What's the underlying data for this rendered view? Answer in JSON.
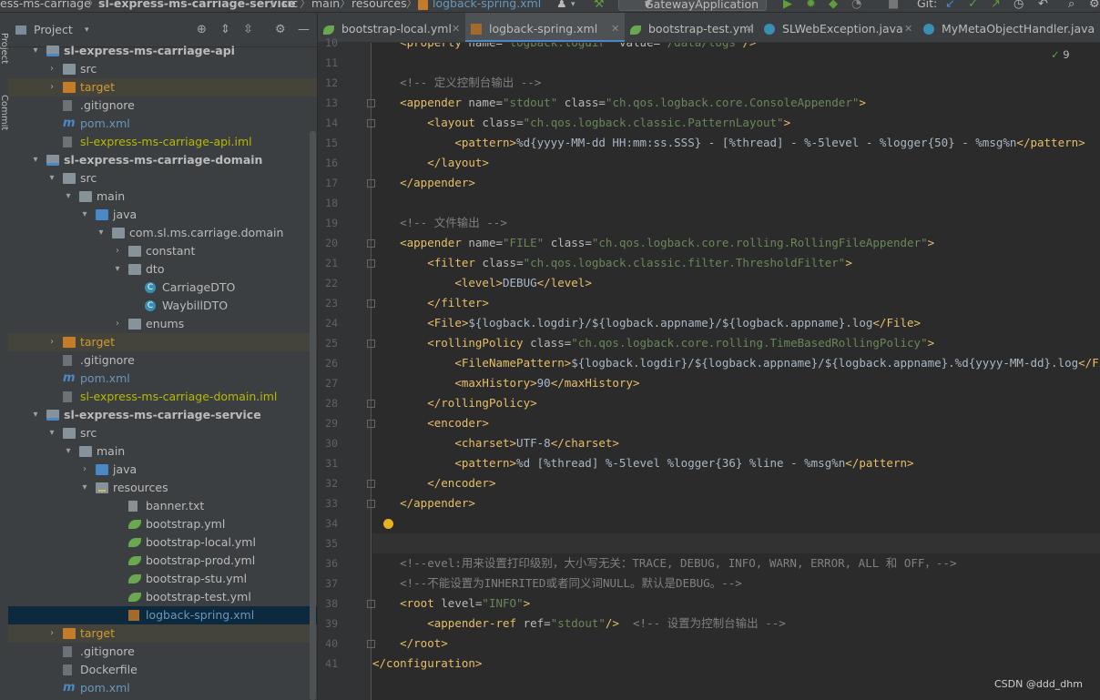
{
  "breadcrumb": {
    "items": [
      "ess-ms-carriage",
      "sl-express-ms-carriage-service",
      "src",
      "main",
      "resources",
      "logback-spring.xml"
    ],
    "separator": "〉",
    "run_config": "GatewayApplication",
    "git_label": "Git:"
  },
  "project_panel": {
    "title": "Project",
    "rows": [
      {
        "depth": 2,
        "arrow": "▾",
        "icon": "folder-mod",
        "label": "sl-express-ms-carriage-api",
        "cls": "c-mod",
        "row": ""
      },
      {
        "depth": 3,
        "arrow": "›",
        "icon": "folder-src",
        "label": "src",
        "cls": "c-norm",
        "row": ""
      },
      {
        "depth": 3,
        "arrow": "›",
        "icon": "folder-target",
        "label": "target",
        "cls": "c-target",
        "row": "excluded"
      },
      {
        "depth": 3,
        "arrow": "",
        "icon": "git",
        "label": ".gitignore",
        "cls": "c-norm",
        "row": ""
      },
      {
        "depth": 3,
        "arrow": "",
        "icon": "maven",
        "label": "pom.xml",
        "cls": "c-pom",
        "row": ""
      },
      {
        "depth": 3,
        "arrow": "",
        "icon": "iml",
        "label": "sl-express-ms-carriage-api.iml",
        "cls": "c-iml",
        "row": ""
      },
      {
        "depth": 2,
        "arrow": "▾",
        "icon": "folder-mod",
        "label": "sl-express-ms-carriage-domain",
        "cls": "c-mod",
        "row": ""
      },
      {
        "depth": 3,
        "arrow": "▾",
        "icon": "folder-src",
        "label": "src",
        "cls": "c-norm",
        "row": ""
      },
      {
        "depth": 4,
        "arrow": "▾",
        "icon": "folder",
        "label": "main",
        "cls": "c-norm",
        "row": ""
      },
      {
        "depth": 5,
        "arrow": "▾",
        "icon": "folder-java",
        "label": "java",
        "cls": "c-norm",
        "row": ""
      },
      {
        "depth": 6,
        "arrow": "▾",
        "icon": "pkg",
        "label": "com.sl.ms.carriage.domain",
        "cls": "c-norm",
        "row": ""
      },
      {
        "depth": 7,
        "arrow": "›",
        "icon": "pkg",
        "label": "constant",
        "cls": "c-norm",
        "row": ""
      },
      {
        "depth": 7,
        "arrow": "▾",
        "icon": "pkg",
        "label": "dto",
        "cls": "c-norm",
        "row": ""
      },
      {
        "depth": 8,
        "arrow": "",
        "icon": "cls",
        "label": "CarriageDTO",
        "cls": "c-norm",
        "row": ""
      },
      {
        "depth": 8,
        "arrow": "",
        "icon": "cls",
        "label": "WaybillDTO",
        "cls": "c-norm",
        "row": ""
      },
      {
        "depth": 7,
        "arrow": "›",
        "icon": "pkg",
        "label": "enums",
        "cls": "c-norm",
        "row": ""
      },
      {
        "depth": 3,
        "arrow": "›",
        "icon": "folder-target",
        "label": "target",
        "cls": "c-target",
        "row": "excluded"
      },
      {
        "depth": 3,
        "arrow": "",
        "icon": "git",
        "label": ".gitignore",
        "cls": "c-norm",
        "row": ""
      },
      {
        "depth": 3,
        "arrow": "",
        "icon": "maven",
        "label": "pom.xml",
        "cls": "c-pom",
        "row": ""
      },
      {
        "depth": 3,
        "arrow": "",
        "icon": "iml",
        "label": "sl-express-ms-carriage-domain.iml",
        "cls": "c-iml",
        "row": ""
      },
      {
        "depth": 2,
        "arrow": "▾",
        "icon": "folder-mod",
        "label": "sl-express-ms-carriage-service",
        "cls": "c-mod",
        "row": ""
      },
      {
        "depth": 3,
        "arrow": "▾",
        "icon": "folder-src",
        "label": "src",
        "cls": "c-norm",
        "row": ""
      },
      {
        "depth": 4,
        "arrow": "▾",
        "icon": "folder",
        "label": "main",
        "cls": "c-norm",
        "row": ""
      },
      {
        "depth": 5,
        "arrow": "›",
        "icon": "folder-java",
        "label": "java",
        "cls": "c-norm",
        "row": ""
      },
      {
        "depth": 5,
        "arrow": "▾",
        "icon": "folder-res",
        "label": "resources",
        "cls": "c-norm",
        "row": ""
      },
      {
        "depth": 7,
        "arrow": "",
        "icon": "txt",
        "label": "banner.txt",
        "cls": "c-norm",
        "row": ""
      },
      {
        "depth": 7,
        "arrow": "",
        "icon": "leaf",
        "label": "bootstrap.yml",
        "cls": "c-norm",
        "row": ""
      },
      {
        "depth": 7,
        "arrow": "",
        "icon": "leaf",
        "label": "bootstrap-local.yml",
        "cls": "c-norm",
        "row": ""
      },
      {
        "depth": 7,
        "arrow": "",
        "icon": "leaf",
        "label": "bootstrap-prod.yml",
        "cls": "c-norm",
        "row": ""
      },
      {
        "depth": 7,
        "arrow": "",
        "icon": "leaf",
        "label": "bootstrap-stu.yml",
        "cls": "c-norm",
        "row": ""
      },
      {
        "depth": 7,
        "arrow": "",
        "icon": "leaf",
        "label": "bootstrap-test.yml",
        "cls": "c-norm",
        "row": ""
      },
      {
        "depth": 7,
        "arrow": "",
        "icon": "xml",
        "label": "logback-spring.xml",
        "cls": "c-sel",
        "row": "selected"
      },
      {
        "depth": 3,
        "arrow": "›",
        "icon": "folder-target",
        "label": "target",
        "cls": "c-target",
        "row": "excluded"
      },
      {
        "depth": 3,
        "arrow": "",
        "icon": "git",
        "label": ".gitignore",
        "cls": "c-norm",
        "row": ""
      },
      {
        "depth": 3,
        "arrow": "",
        "icon": "docker",
        "label": "Dockerfile",
        "cls": "c-norm",
        "row": ""
      },
      {
        "depth": 3,
        "arrow": "",
        "icon": "maven",
        "label": "pom.xml",
        "cls": "c-pom",
        "row": ""
      }
    ]
  },
  "tabs": [
    {
      "label": "bootstrap-local.yml",
      "icon": "leaf",
      "active": false
    },
    {
      "label": "logback-spring.xml",
      "icon": "xml",
      "active": true
    },
    {
      "label": "bootstrap-test.yml",
      "icon": "leaf",
      "active": false
    },
    {
      "label": "SLWebException.java",
      "icon": "cls",
      "active": false
    },
    {
      "label": "MyMetaObjectHandler.java",
      "icon": "cls",
      "active": false
    }
  ],
  "editor": {
    "inspection_count": "9",
    "first_line": 10,
    "current_line": 35,
    "lines": [
      [
        [
          "    ",
          "txt"
        ],
        [
          "<property ",
          "tag"
        ],
        [
          "name=",
          "attr"
        ],
        [
          "\"logback.logdir\"",
          "val"
        ],
        [
          " value=",
          "attr"
        ],
        [
          "\"/data/logs\"",
          "val"
        ],
        [
          "/>",
          "tag"
        ]
      ],
      [],
      [
        [
          "    ",
          "txt"
        ],
        [
          "<!-- 定义控制台输出 -->",
          "cmt"
        ]
      ],
      [
        [
          "    ",
          "txt"
        ],
        [
          "<appender ",
          "tag"
        ],
        [
          "name=",
          "attr"
        ],
        [
          "\"stdout\"",
          "val"
        ],
        [
          " class=",
          "attr"
        ],
        [
          "\"ch.qos.logback.core.ConsoleAppender\"",
          "val"
        ],
        [
          ">",
          "tag"
        ]
      ],
      [
        [
          "        ",
          "txt"
        ],
        [
          "<layout ",
          "tag"
        ],
        [
          "class=",
          "attr"
        ],
        [
          "\"ch.qos.logback.classic.PatternLayout\"",
          "val"
        ],
        [
          ">",
          "tag"
        ]
      ],
      [
        [
          "            ",
          "txt"
        ],
        [
          "<pattern>",
          "tag"
        ],
        [
          "%d{yyyy-MM-dd HH:mm:ss.SSS} - [%thread] - %-5level - %logger{50} - %msg%n",
          "txt"
        ],
        [
          "</pattern>",
          "tag"
        ]
      ],
      [
        [
          "        ",
          "txt"
        ],
        [
          "</layout>",
          "tag"
        ]
      ],
      [
        [
          "    ",
          "txt"
        ],
        [
          "</appender>",
          "tag"
        ]
      ],
      [],
      [
        [
          "    ",
          "txt"
        ],
        [
          "<!-- 文件输出 -->",
          "cmt"
        ]
      ],
      [
        [
          "    ",
          "txt"
        ],
        [
          "<appender ",
          "tag"
        ],
        [
          "name=",
          "attr"
        ],
        [
          "\"FILE\"",
          "val"
        ],
        [
          " class=",
          "attr"
        ],
        [
          "\"ch.qos.logback.core.rolling.RollingFileAppender\"",
          "val"
        ],
        [
          ">",
          "tag"
        ]
      ],
      [
        [
          "        ",
          "txt"
        ],
        [
          "<filter ",
          "tag"
        ],
        [
          "class=",
          "attr"
        ],
        [
          "\"ch.qos.logback.classic.filter.ThresholdFilter\"",
          "val"
        ],
        [
          ">",
          "tag"
        ]
      ],
      [
        [
          "            ",
          "txt"
        ],
        [
          "<level>",
          "tag"
        ],
        [
          "DEBUG",
          "txt"
        ],
        [
          "</level>",
          "tag"
        ]
      ],
      [
        [
          "        ",
          "txt"
        ],
        [
          "</filter>",
          "tag"
        ]
      ],
      [
        [
          "        ",
          "txt"
        ],
        [
          "<File>",
          "tag"
        ],
        [
          "${logback.logdir}/${logback.appname}/${logback.appname}.log",
          "txt"
        ],
        [
          "</File>",
          "tag"
        ]
      ],
      [
        [
          "        ",
          "txt"
        ],
        [
          "<rollingPolicy ",
          "tag"
        ],
        [
          "class=",
          "attr"
        ],
        [
          "\"ch.qos.logback.core.rolling.TimeBasedRollingPolicy\"",
          "val"
        ],
        [
          ">",
          "tag"
        ]
      ],
      [
        [
          "            ",
          "txt"
        ],
        [
          "<FileNamePattern>",
          "tag"
        ],
        [
          "${logback.logdir}/${logback.appname}/${logback.appname}.%d{yyyy-MM-dd}.log",
          "txt"
        ],
        [
          "</FileNamePattern>",
          "tag"
        ]
      ],
      [
        [
          "            ",
          "txt"
        ],
        [
          "<maxHistory>",
          "tag"
        ],
        [
          "90",
          "txt"
        ],
        [
          "</maxHistory>",
          "tag"
        ]
      ],
      [
        [
          "        ",
          "txt"
        ],
        [
          "</rollingPolicy>",
          "tag"
        ]
      ],
      [
        [
          "        ",
          "txt"
        ],
        [
          "<encoder>",
          "tag"
        ]
      ],
      [
        [
          "            ",
          "txt"
        ],
        [
          "<charset>",
          "tag"
        ],
        [
          "UTF-8",
          "txt"
        ],
        [
          "</charset>",
          "tag"
        ]
      ],
      [
        [
          "            ",
          "txt"
        ],
        [
          "<pattern>",
          "tag"
        ],
        [
          "%d [%thread] %-5level %logger{36} %line - %msg%n",
          "txt"
        ],
        [
          "</pattern>",
          "tag"
        ]
      ],
      [
        [
          "        ",
          "txt"
        ],
        [
          "</encoder>",
          "tag"
        ]
      ],
      [
        [
          "    ",
          "txt"
        ],
        [
          "</appender>",
          "tag"
        ]
      ],
      [],
      [],
      [
        [
          "    ",
          "txt"
        ],
        [
          "<!--evel:用来设置打印级别，大小写无关：TRACE, DEBUG, INFO, WARN, ERROR, ALL 和 OFF，-->",
          "cmt"
        ]
      ],
      [
        [
          "    ",
          "txt"
        ],
        [
          "<!--不能设置为INHERITED或者同义词NULL。默认是DEBUG。-->",
          "cmt"
        ]
      ],
      [
        [
          "    ",
          "txt"
        ],
        [
          "<root ",
          "tag"
        ],
        [
          "level=",
          "attr"
        ],
        [
          "\"INFO\"",
          "val"
        ],
        [
          ">",
          "tag"
        ]
      ],
      [
        [
          "        ",
          "txt"
        ],
        [
          "<appender-ref ",
          "tag"
        ],
        [
          "ref=",
          "attr"
        ],
        [
          "\"stdout\"",
          "val"
        ],
        [
          "/>",
          "tag"
        ],
        [
          "  <!-- 设置为控制台输出 -->",
          "cmt"
        ]
      ],
      [
        [
          "    ",
          "txt"
        ],
        [
          "</root>",
          "tag"
        ]
      ],
      [
        [
          "",
          "txt"
        ],
        [
          "</configuration>",
          "tag"
        ]
      ]
    ]
  },
  "watermark": "CSDN @ddd_dhm"
}
